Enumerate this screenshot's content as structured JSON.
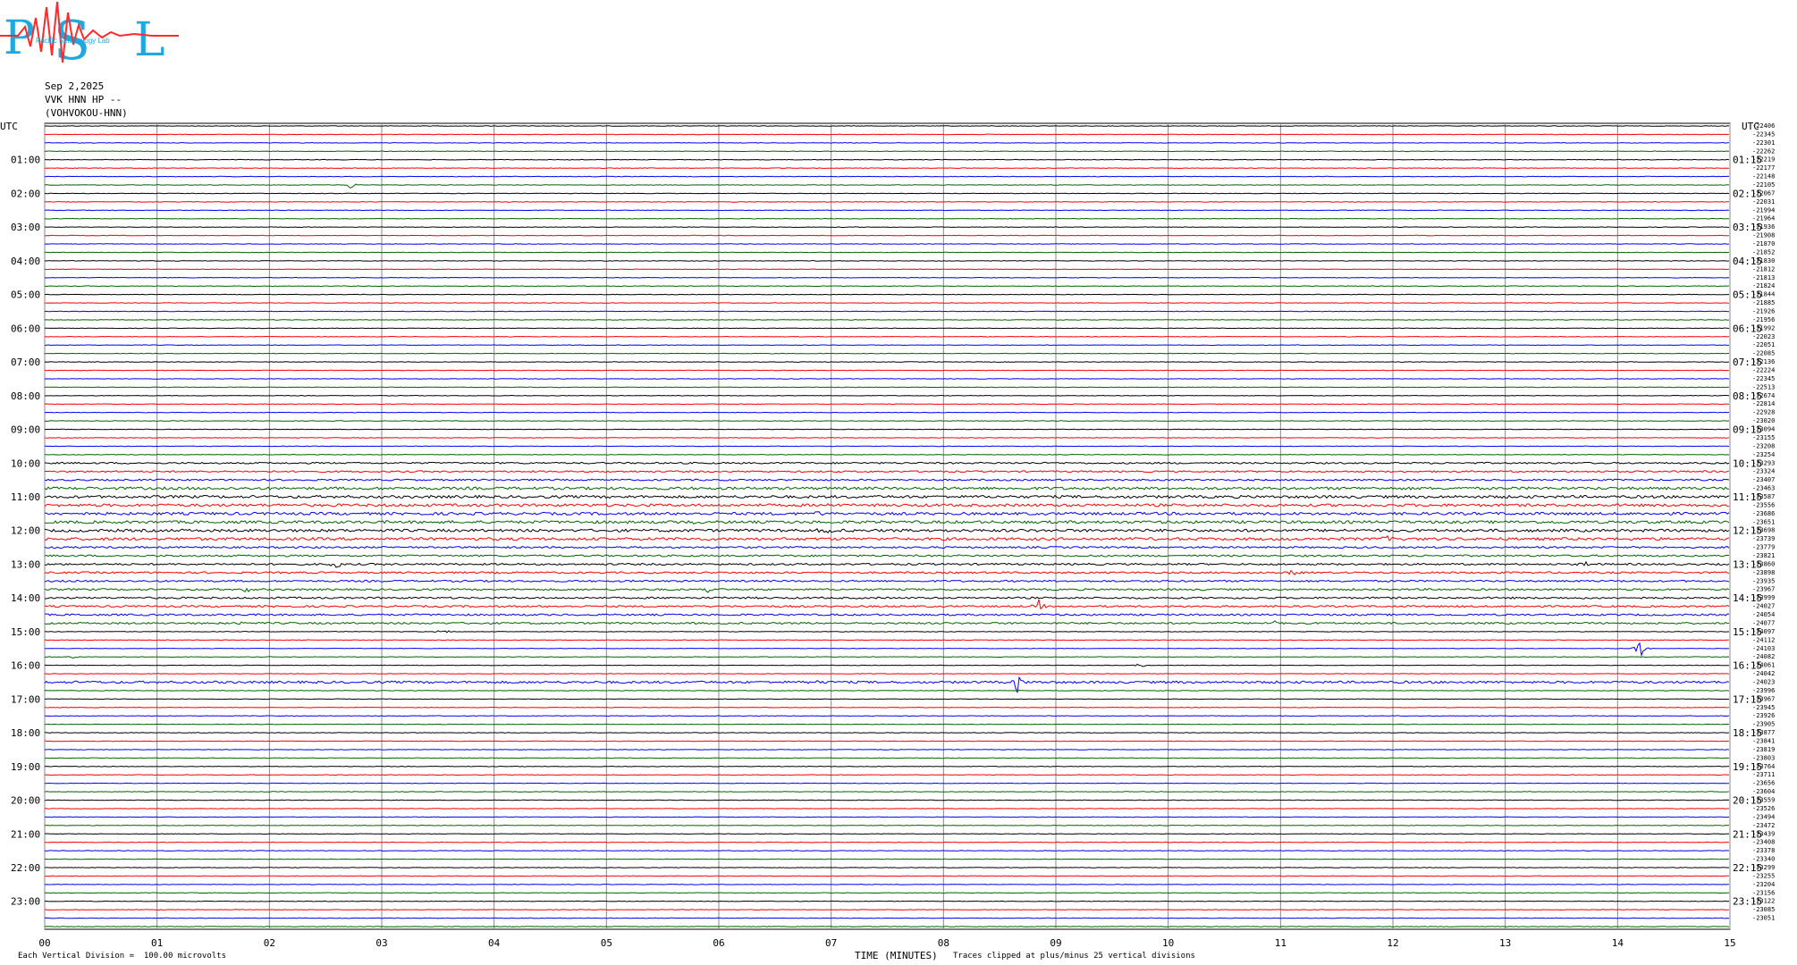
{
  "logo": {
    "letters": "PSL",
    "text": "Pacific Seismology Lab",
    "colors": {
      "letters": "#1ea8e0",
      "trace": "#ff2a2a"
    }
  },
  "header": {
    "date": "Sep 2,2025",
    "station": "VVK HNN HP --",
    "location": "(VOHVOKOU-HNN)"
  },
  "axis": {
    "left_label": "UTC",
    "right_label": "UTC"
  },
  "footer": {
    "scale_note": "Each Vertical Division =  100.00 microvolts",
    "xlabel": "TIME (MINUTES)",
    "clip_note": "Traces clipped at plus/minus 25 vertical divisions"
  },
  "chart_data": {
    "type": "line",
    "subtype": "helicorder",
    "xlim": [
      0,
      15
    ],
    "x_ticks": [
      "00",
      "01",
      "02",
      "03",
      "04",
      "05",
      "06",
      "07",
      "08",
      "09",
      "10",
      "11",
      "12",
      "13",
      "14",
      "15"
    ],
    "left_time_labels": [
      "01:00",
      "02:00",
      "03:00",
      "04:00",
      "05:00",
      "06:00",
      "07:00",
      "08:00",
      "09:00",
      "10:00",
      "11:00",
      "12:00",
      "13:00",
      "14:00",
      "15:00",
      "16:00",
      "17:00",
      "18:00",
      "19:00",
      "20:00",
      "21:00",
      "22:00",
      "23:00"
    ],
    "right_time_labels": [
      "01:15",
      "02:15",
      "03:15",
      "04:15",
      "05:15",
      "06:15",
      "07:15",
      "08:15",
      "09:15",
      "10:15",
      "11:15",
      "12:15",
      "13:15",
      "14:15",
      "15:15",
      "16:15",
      "17:15",
      "18:15",
      "19:15",
      "20:15",
      "21:15",
      "22:15",
      "23:15"
    ],
    "trace_colors": [
      "#000000",
      "#ff0000",
      "#0000ff",
      "#006400"
    ],
    "trace_count": 96,
    "grid": true,
    "right_counts": [
      -22406,
      -22345,
      -22301,
      -22262,
      -22219,
      -22177,
      -22148,
      -22105,
      -22067,
      -22031,
      -21994,
      -21964,
      -21936,
      -21908,
      -21870,
      -21852,
      -21830,
      -21812,
      -21813,
      -21824,
      -21844,
      -21885,
      -21926,
      -21956,
      -21992,
      -22023,
      -22051,
      -22085,
      -22136,
      -22224,
      -22345,
      -22513,
      -22674,
      -22814,
      -22928,
      -23020,
      -23094,
      -23155,
      -23208,
      -23254,
      -23293,
      -23324,
      -23407,
      -23463,
      -23587,
      -23556,
      -23686,
      -23651,
      -23698,
      -23739,
      -23779,
      -23821,
      -23860,
      -23898,
      -23935,
      -23967,
      -23999,
      -24027,
      -24054,
      -24077,
      -24097,
      -24112,
      -24103,
      -24082,
      -24061,
      -24042,
      -24023,
      -23996,
      -23967,
      -23945,
      -23926,
      -23905,
      -23877,
      -23841,
      -23819,
      -23803,
      -23764,
      -23711,
      -23656,
      -23604,
      -23559,
      -23526,
      -23494,
      -23472,
      -23439,
      -23408,
      -23378,
      -23340,
      -23299,
      -23255,
      -23204,
      -23156,
      -23122,
      -23085,
      -23051
    ],
    "events": [
      {
        "trace": 7,
        "minute": 2.73,
        "amplitude": 5
      },
      {
        "trace": 45,
        "minute": 6.95,
        "amplitude": 4
      },
      {
        "trace": 46,
        "minute": 6.9,
        "amplitude": 5
      },
      {
        "trace": 47,
        "minute": 5.8,
        "amplitude": 3
      },
      {
        "trace": 48,
        "minute": 6.95,
        "amplitude": 6
      },
      {
        "trace": 48,
        "minute": 7.85,
        "amplitude": 4
      },
      {
        "trace": 48,
        "minute": 13.3,
        "amplitude": 3
      },
      {
        "trace": 49,
        "minute": 11.95,
        "amplitude": 5
      },
      {
        "trace": 52,
        "minute": 2.6,
        "amplitude": 6
      },
      {
        "trace": 52,
        "minute": 13.7,
        "amplitude": 5
      },
      {
        "trace": 53,
        "minute": 11.1,
        "amplitude": 5
      },
      {
        "trace": 55,
        "minute": 5.9,
        "amplitude": 4
      },
      {
        "trace": 55,
        "minute": 1.8,
        "amplitude": 4
      },
      {
        "trace": 57,
        "minute": 8.85,
        "amplitude": 8
      },
      {
        "trace": 59,
        "minute": 1.75,
        "amplitude": 3
      },
      {
        "trace": 59,
        "minute": 10.95,
        "amplitude": 3
      },
      {
        "trace": 60,
        "minute": 3.55,
        "amplitude": 5
      },
      {
        "trace": 62,
        "minute": 14.2,
        "amplitude": 12
      },
      {
        "trace": 63,
        "minute": 0.25,
        "amplitude": 3
      },
      {
        "trace": 64,
        "minute": 9.75,
        "amplitude": 4
      },
      {
        "trace": 66,
        "minute": 6.85,
        "amplitude": 5
      },
      {
        "trace": 66,
        "minute": 8.65,
        "amplitude": 14
      }
    ],
    "noisy_bands": [
      {
        "from": 43,
        "to": 50,
        "level": 3
      },
      {
        "from": 40,
        "to": 43,
        "level": 1.8
      },
      {
        "from": 50,
        "to": 60,
        "level": 2
      },
      {
        "from": 66,
        "to": 67,
        "level": 2.5
      }
    ]
  }
}
